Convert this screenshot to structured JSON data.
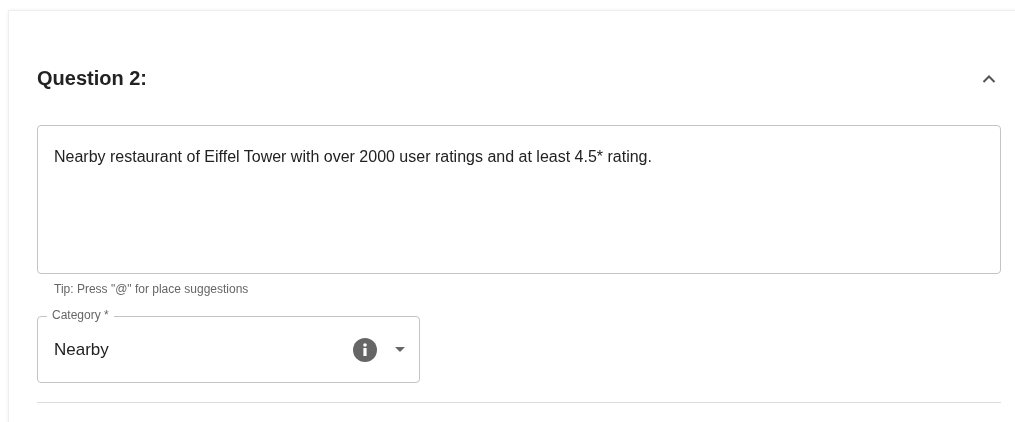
{
  "question": {
    "title": "Question 2:",
    "expanded": true,
    "text_field": {
      "value": "Nearby restaurant of Eiffel Tower with over 2000 user ratings and at least 4.5* rating."
    },
    "tip": "Tip: Press \"@\" for place suggestions",
    "category": {
      "label": "Category *",
      "value": "Nearby"
    }
  }
}
